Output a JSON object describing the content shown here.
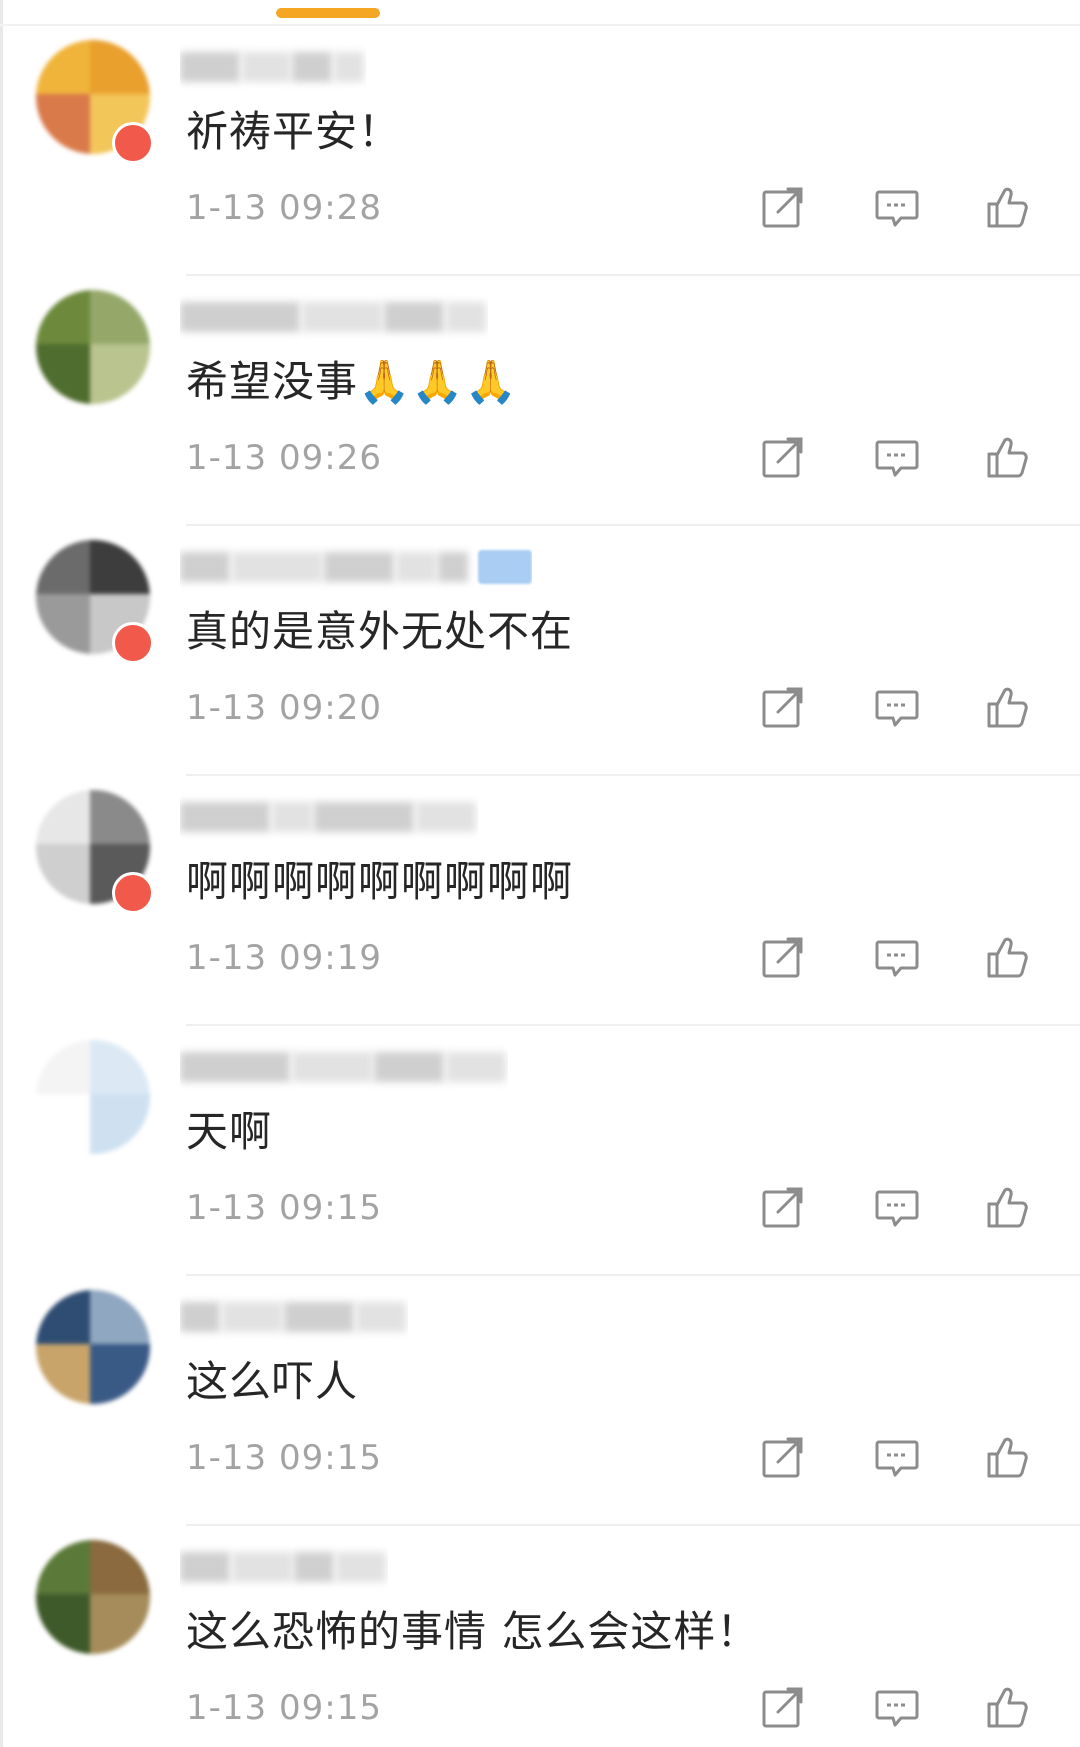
{
  "colors": {
    "accent": "#f5a623",
    "text": "#262626",
    "meta": "#a3a3a3",
    "icon": "#8c8c8c",
    "badge": "#f15a4a"
  },
  "icons": {
    "share": "share-icon",
    "comment": "comment-icon",
    "like": "like-icon"
  },
  "comments": [
    {
      "text": "祈祷平安！",
      "time": "1-13 09:28",
      "avatar_colors": [
        "#f0b43a",
        "#e9a02d",
        "#d97a4a",
        "#f3c65a"
      ],
      "badge": true,
      "verified": false
    },
    {
      "text": "希望没事🙏🙏🙏",
      "time": "1-13 09:26",
      "avatar_colors": [
        "#6d8a3c",
        "#95a86a",
        "#4f6d2f",
        "#b9c48f"
      ],
      "badge": false,
      "verified": false
    },
    {
      "text": "真的是意外无处不在",
      "time": "1-13 09:20",
      "avatar_colors": [
        "#6b6b6b",
        "#3d3d3d",
        "#9a9a9a",
        "#c8c8c8"
      ],
      "badge": true,
      "verified": true
    },
    {
      "text": "啊啊啊啊啊啊啊啊啊",
      "time": "1-13 09:19",
      "avatar_colors": [
        "#e7e7e7",
        "#8a8a8a",
        "#cfcfcf",
        "#5a5a5a"
      ],
      "badge": true,
      "verified": false
    },
    {
      "text": "天啊",
      "time": "1-13 09:15",
      "avatar_colors": [
        "#f4f4f4",
        "#dce9f5",
        "#ffffff",
        "#cfe1f1"
      ],
      "badge": false,
      "verified": false
    },
    {
      "text": "这么吓人",
      "time": "1-13 09:15",
      "avatar_colors": [
        "#2f4d73",
        "#8fa7c0",
        "#c8a46a",
        "#3a5a86"
      ],
      "badge": false,
      "verified": false
    },
    {
      "text": "这么恐怖的事情  怎么会这样！",
      "time": "1-13 09:15",
      "avatar_colors": [
        "#5b7a3a",
        "#8a6a3e",
        "#3f5a2a",
        "#a58c5a"
      ],
      "badge": false,
      "verified": false
    }
  ]
}
